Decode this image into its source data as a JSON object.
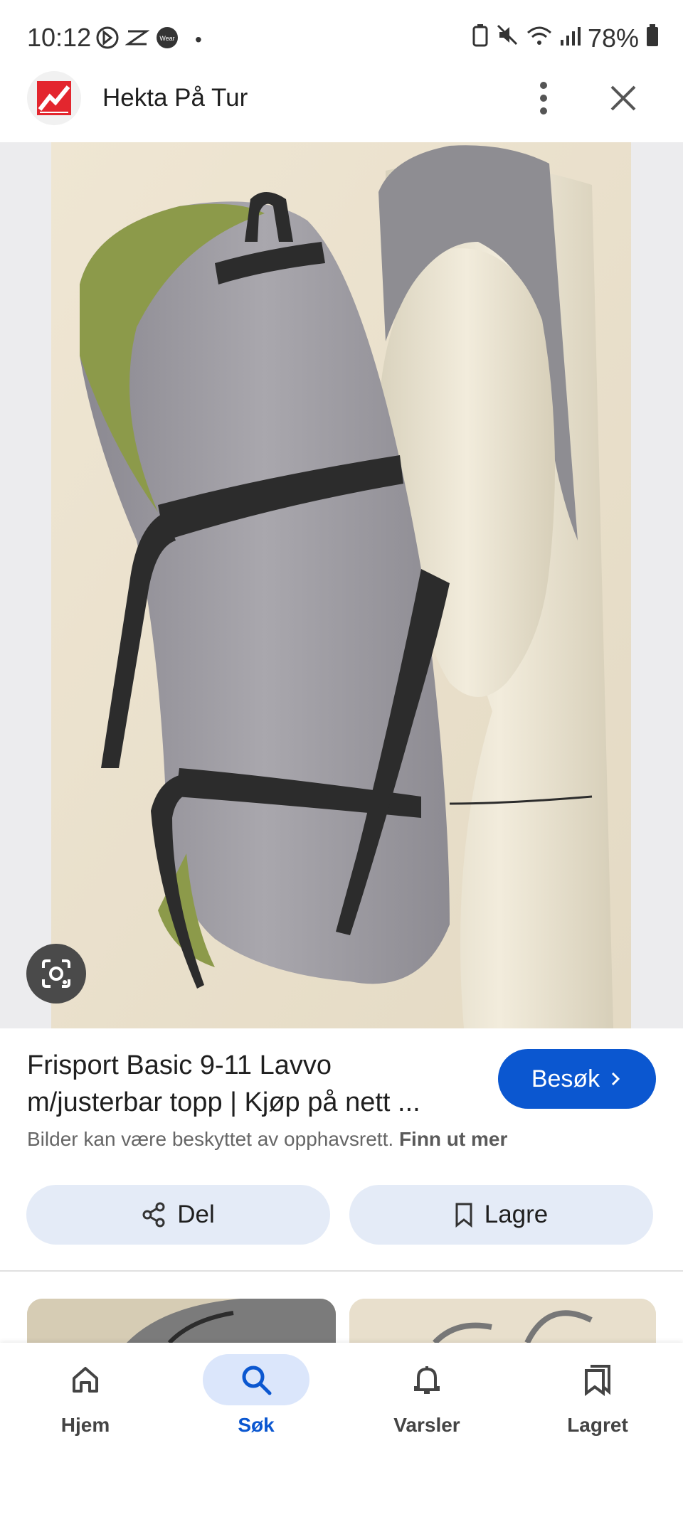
{
  "status_bar": {
    "time": "10:12",
    "battery": "78%",
    "dot": "•"
  },
  "header": {
    "site_name": "Hekta På Tur"
  },
  "result": {
    "title_line1": "Frisport Basic 9-11 Lavvo",
    "title_line2": "m/justerbar topp | Kjøp på nett ...",
    "visit_label": "Besøk",
    "copyright_text": "Bilder kan være beskyttet av opphavsrett.",
    "learn_more": "Finn ut mer"
  },
  "actions": {
    "share_label": "Del",
    "save_label": "Lagre"
  },
  "bottom_nav": {
    "home": "Hjem",
    "search": "Søk",
    "alerts": "Varsler",
    "saved": "Lagret"
  },
  "colors": {
    "accent": "#0b57d0",
    "chip_bg": "#e4ebf7",
    "active_nav_bg": "#dbe6fb"
  }
}
